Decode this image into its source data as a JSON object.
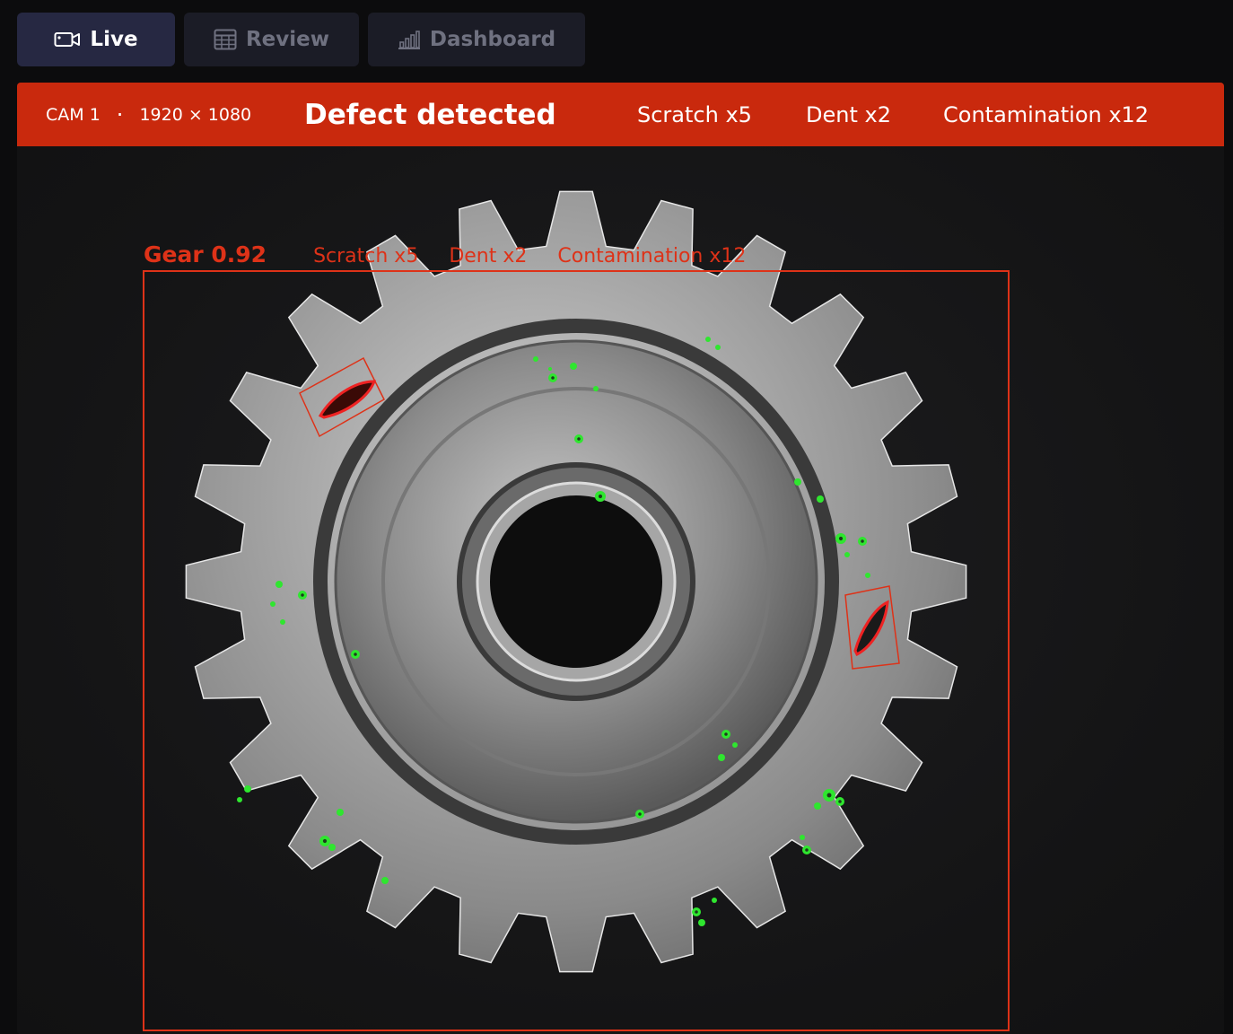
{
  "tabs": [
    {
      "label": "Live",
      "icon": "video-camera-icon",
      "active": true
    },
    {
      "label": "Review",
      "icon": "table-icon",
      "active": false
    },
    {
      "label": "Dashboard",
      "icon": "bar-chart-icon",
      "active": false
    }
  ],
  "banner": {
    "camera": "CAM 1",
    "separator": "·",
    "resolution": "1920 × 1080",
    "status": "Defect detected",
    "counts": [
      "Scratch x5",
      "Dent x2",
      "Contamination x12"
    ]
  },
  "detection": {
    "object_label": "Gear 0.92",
    "defect_labels": [
      "Scratch x5",
      "Dent x2",
      "Contamination x12"
    ]
  },
  "colors": {
    "alert": "#c9290d",
    "box": "#de3218",
    "contamination": "#2fe62f",
    "tab_active": "#262842",
    "tab_inactive": "#1b1c26"
  }
}
